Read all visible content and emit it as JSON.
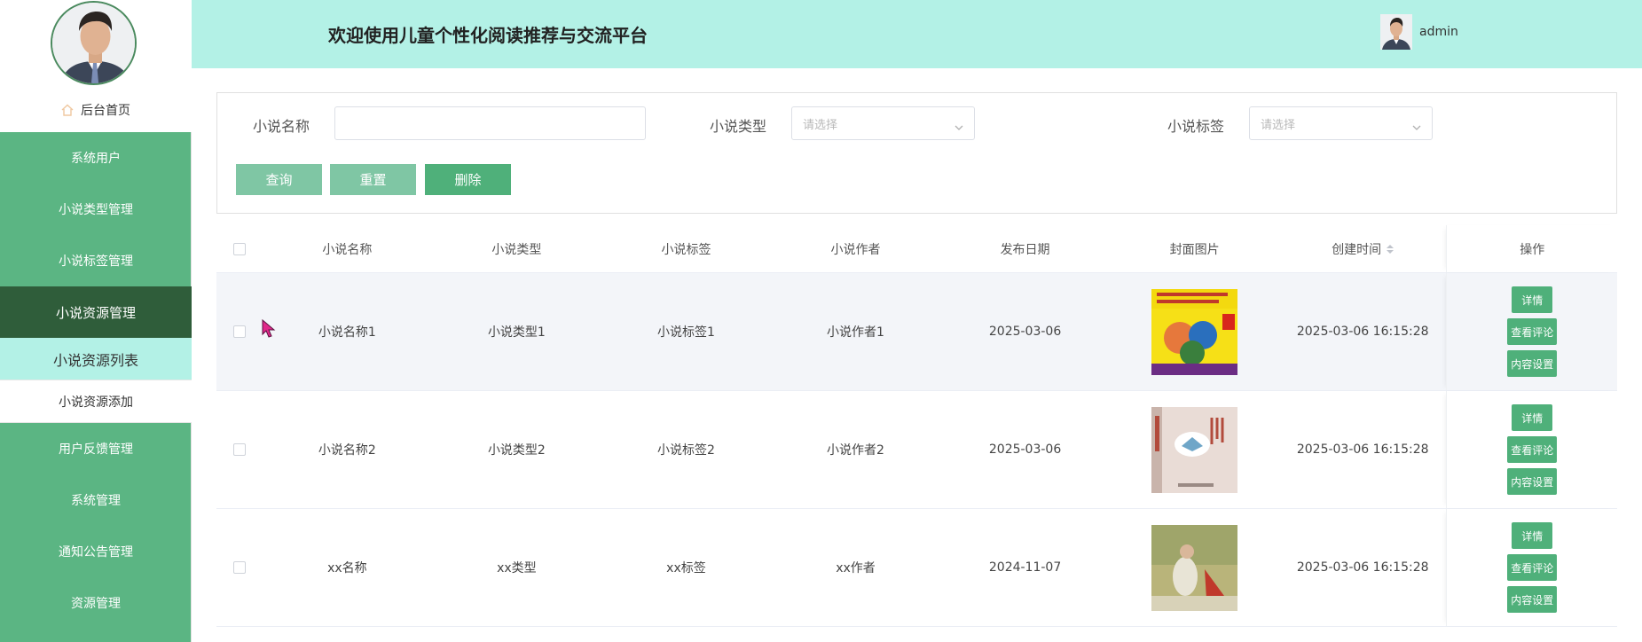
{
  "sidebar": {
    "home": "后台首页",
    "menu_top": [
      "系统用户",
      "小说类型管理",
      "小说标签管理",
      "小说资源管理"
    ],
    "submenu": [
      "小说资源列表",
      "小说资源添加"
    ],
    "menu_bottom": [
      "用户反馈管理",
      "系统管理",
      "通知公告管理",
      "资源管理"
    ]
  },
  "header": {
    "title": "欢迎使用儿童个性化阅读推荐与交流平台",
    "username": "admin"
  },
  "search": {
    "name_label": "小说名称",
    "name_value": "",
    "type_label": "小说类型",
    "type_placeholder": "请选择",
    "tag_label": "小说标签",
    "tag_placeholder": "请选择",
    "query_button": "查询",
    "reset_button": "重置",
    "delete_button": "删除"
  },
  "table": {
    "headers": [
      "小说名称",
      "小说类型",
      "小说标签",
      "小说作者",
      "发布日期",
      "封面图片",
      "创建时间",
      "操作"
    ],
    "rows": [
      {
        "name": "小说名称1",
        "type": "小说类型1",
        "tag": "小说标签1",
        "author": "小说作者1",
        "date": "2025-03-06",
        "created": "2025-03-06 16:15:28"
      },
      {
        "name": "小说名称2",
        "type": "小说类型2",
        "tag": "小说标签2",
        "author": "小说作者2",
        "date": "2025-03-06",
        "created": "2025-03-06 16:15:28"
      },
      {
        "name": "xx名称",
        "type": "xx类型",
        "tag": "xx标签",
        "author": "xx作者",
        "date": "2024-11-07",
        "created": "2025-03-06 16:15:28"
      }
    ],
    "ops": {
      "detail": "详情",
      "comments": "查看评论",
      "content": "内容设置"
    }
  },
  "colors": {
    "sidebar": "#5bb583",
    "sidebar_active": "#2f5d3a",
    "header": "#b3f1e6",
    "button": "#4fb07a"
  }
}
